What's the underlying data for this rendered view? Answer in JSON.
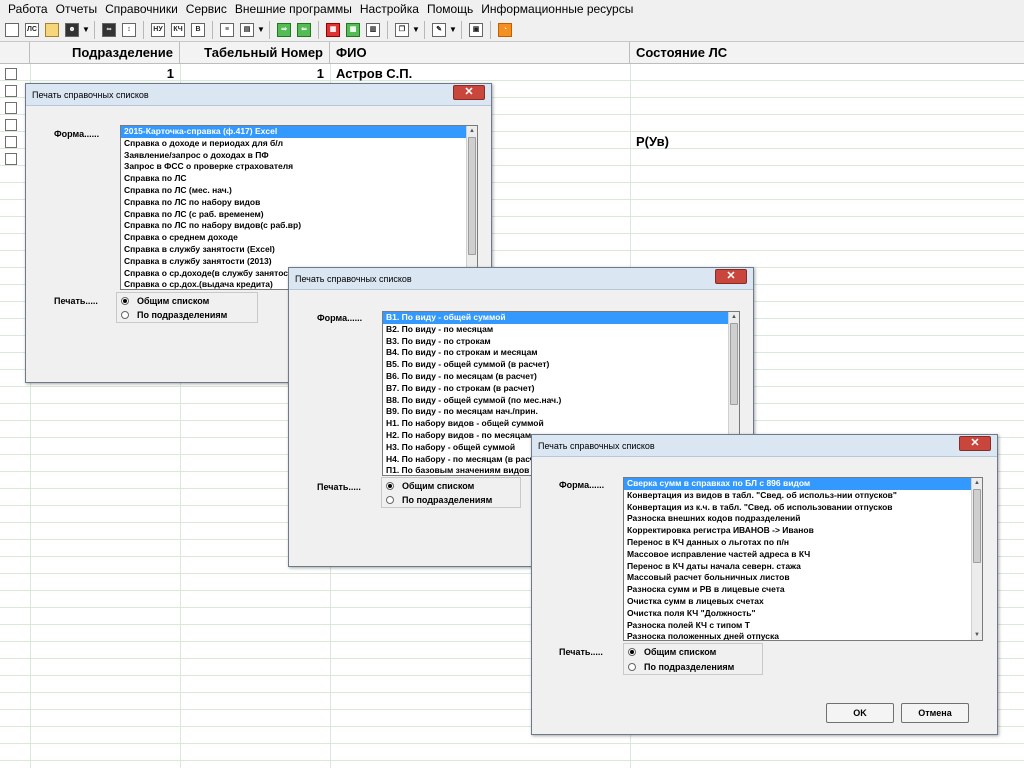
{
  "menu": [
    "Работа",
    "Отчеты",
    "Справочники",
    "Сервис",
    "Внешние программы",
    "Настройка",
    "Помощь",
    "Информационные ресурсы"
  ],
  "toolbar": {
    "nu_label": "НУ",
    "kch_label": "КЧ",
    "ref_label": "В"
  },
  "grid": {
    "columns": [
      "Подразделение",
      "Табельный Номер",
      "ФИО",
      "Состояние ЛС"
    ],
    "rows": [
      {
        "dept": "1",
        "tab": "1",
        "fio": "Астров С.П.",
        "state": ""
      },
      {
        "dept": "",
        "tab": "",
        "fio": "",
        "state": ""
      },
      {
        "dept": "",
        "tab": "",
        "fio": "",
        "state": ""
      },
      {
        "dept": "",
        "tab": "",
        "fio": "",
        "state": ""
      },
      {
        "dept": "",
        "tab": "",
        "fio": "",
        "state": "Р(Ув)"
      },
      {
        "dept": "",
        "tab": "",
        "fio": "",
        "state": ""
      }
    ]
  },
  "dialogs": [
    {
      "title": "Печать справочных списков",
      "close": "✕",
      "form_label": "Форма......",
      "print_label": "Печать.....",
      "items": [
        "2015-Карточка-справка (ф.417) Excel",
        "Справка о доходе и периодах для б/л",
        "Заявление/запрос о доходах в ПФ",
        "Запрос в ФСС о проверке страхователя",
        "Справка по ЛС",
        "Справка по ЛС (мес. нач.)",
        "Справка по ЛС по набору видов",
        "Справка по ЛС (с раб. временем)",
        "Справка по ЛС по набору видов(с раб.вр)",
        "Справка о среднем доходе",
        "Справка в службу занятости (Excel)",
        "Справка в службу занятости (2013)",
        "Справка о ср.доходе(в службу занятости)",
        "Справка о ср.дох.(выдача кредита)"
      ],
      "selected": 0,
      "radio": [
        "Общим списком",
        "По подразделениям"
      ],
      "radio_selected": 0
    },
    {
      "title": "Печать справочных списков",
      "close": "✕",
      "form_label": "Форма......",
      "print_label": "Печать.....",
      "items": [
        "В1. По виду - общей суммой",
        "В2. По виду - по месяцам",
        "В3. По виду - по строкам",
        "В4. По виду - по строкам и месяцам",
        "В5. По виду - общей суммой   (в расчет)",
        "В6. По виду - по месяцам      (в расчет)",
        "В7. По виду - по строкам      (в расчет)",
        "В8. По виду - общей суммой (по мес.нач.)",
        "В9. По виду - по месяцам нач./прин.",
        "Н1. По набору видов - общей суммой",
        "Н2. По набору видов - по месяцам",
        "Н3. По набору - общей суммой",
        "Н4. По набору - по месяцам   (в расчет)",
        "П1. По базовым значениям видов"
      ],
      "selected": 0,
      "radio": [
        "Общим списком",
        "По подразделениям"
      ],
      "radio_selected": 0
    },
    {
      "title": "Печать справочных списков",
      "close": "✕",
      "form_label": "Форма......",
      "print_label": "Печать.....",
      "items": [
        "Сверка сумм в справках по БЛ с 896 видом",
        "Конвертация из видов в табл. \"Свед. об использ-нии отпусков\"",
        "Конвертация из к.ч. в табл. \"Свед. об использовании отпусков",
        "Разноска внешних кодов подразделений",
        "Корректировка регистра ИВАНОВ -> Иванов",
        "Перенос в КЧ данных о льготах по п/н",
        "Массовое исправление частей адреса в КЧ",
        "Перенос в КЧ даты начала северн. стажа",
        "Массовый расчет больничных листов",
        "Разноска сумм и РВ в лицевые счета",
        "Очистка сумм в лицевых счетах",
        "Очистка поля КЧ \"Должность\"",
        "Разноска полей КЧ с типом Т",
        "Разноска положенных дней отпуска"
      ],
      "selected": 0,
      "radio": [
        "Общим списком",
        "По подразделениям"
      ],
      "radio_selected": 0,
      "ok": "OK",
      "cancel": "Отмена"
    }
  ]
}
